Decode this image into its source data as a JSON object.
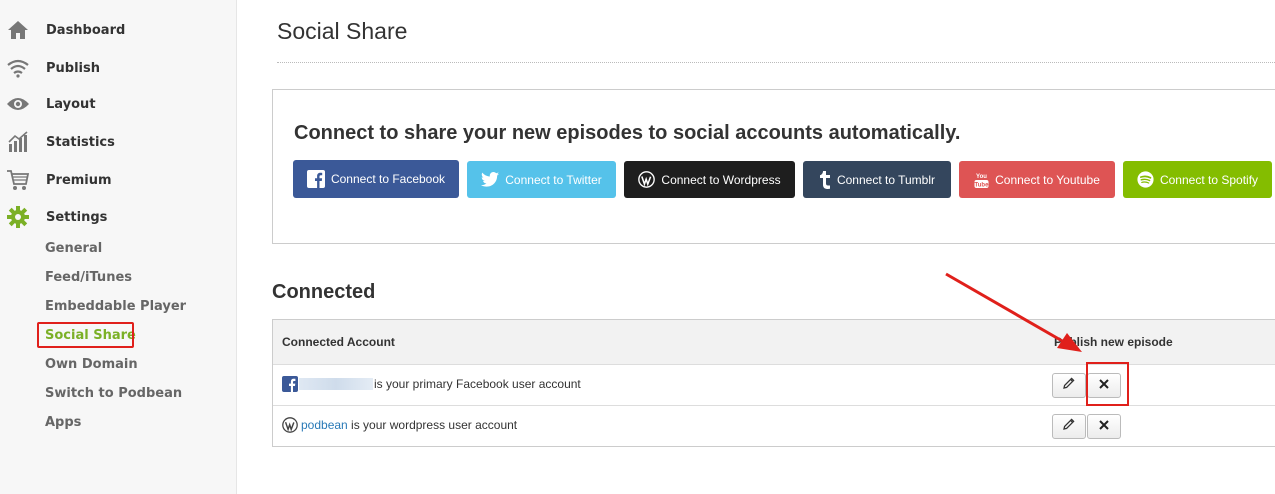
{
  "sidebar": {
    "items": [
      {
        "label": "Dashboard",
        "icon": "home-icon"
      },
      {
        "label": "Publish",
        "icon": "wifi-icon"
      },
      {
        "label": "Layout",
        "icon": "eye-icon"
      },
      {
        "label": "Statistics",
        "icon": "bar-chart-icon"
      },
      {
        "label": "Premium",
        "icon": "cart-icon"
      },
      {
        "label": "Settings",
        "icon": "gear-icon"
      }
    ],
    "settings_sub": [
      {
        "label": "General"
      },
      {
        "label": "Feed/iTunes"
      },
      {
        "label": "Embeddable Player"
      },
      {
        "label": "Social Share"
      },
      {
        "label": "Own Domain"
      },
      {
        "label": "Switch to Podbean"
      },
      {
        "label": "Apps"
      }
    ],
    "active_sub": "Social Share",
    "accent_color": "#7bb026"
  },
  "page": {
    "title": "Social Share"
  },
  "connect": {
    "heading": "Connect to share your new episodes to social accounts automatically.",
    "buttons": [
      {
        "label": "Connect to Facebook",
        "icon": "facebook-icon",
        "color": "#3b5998"
      },
      {
        "label": "Connect to Twitter",
        "icon": "twitter-icon",
        "color": "#55c2ea"
      },
      {
        "label": "Connect to Wordpress",
        "icon": "wordpress-icon",
        "color": "#1e1e1e"
      },
      {
        "label": "Connect to Tumblr",
        "icon": "tumblr-icon",
        "color": "#34465d"
      },
      {
        "label": "Connect to Youtube",
        "icon": "youtube-icon",
        "color": "#de5454"
      },
      {
        "label": "Connect to Spotify",
        "icon": "spotify-icon",
        "color": "#84bd00"
      }
    ]
  },
  "connected": {
    "heading": "Connected",
    "columns": [
      "Connected Account",
      "Publish new episode"
    ],
    "rows": [
      {
        "icon": "facebook-icon",
        "account": "",
        "text": "is your primary Facebook user account"
      },
      {
        "icon": "wordpress-icon",
        "account": "podbean",
        "text": " is your wordpress user account"
      }
    ]
  },
  "annotation_color": "#e0201b"
}
